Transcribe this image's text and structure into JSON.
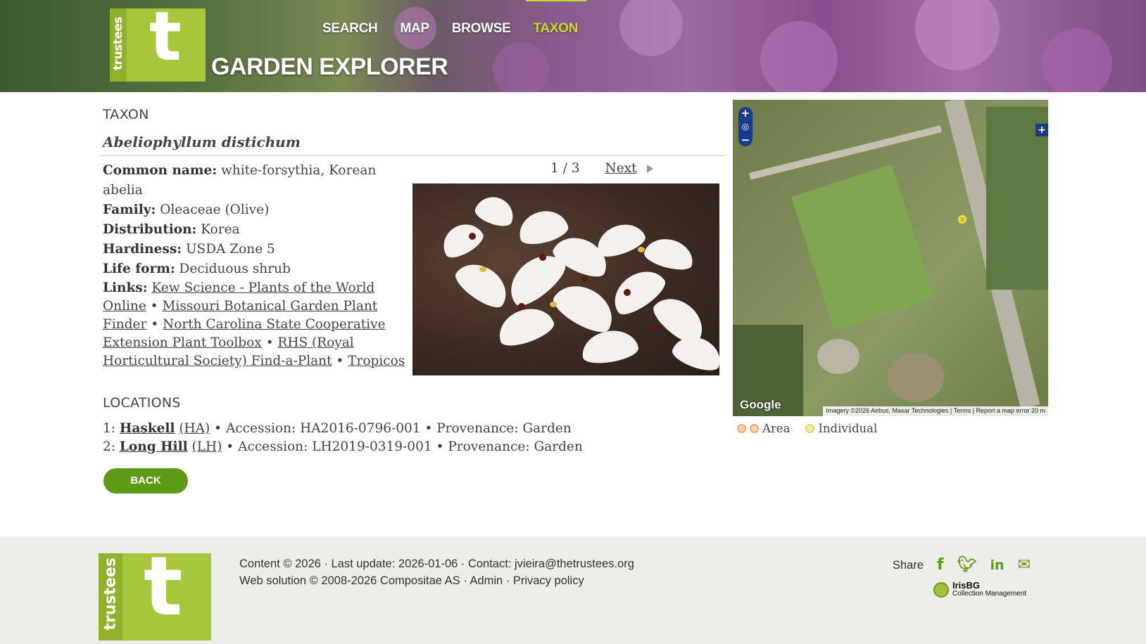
{
  "header": {
    "logo_word": "trustees",
    "logo_letter": "t",
    "site_title": "GARDEN EXPLORER",
    "nav": [
      {
        "label": "SEARCH"
      },
      {
        "label": "MAP"
      },
      {
        "label": "BROWSE"
      },
      {
        "label": "TAXON",
        "active": true
      }
    ]
  },
  "taxon": {
    "section_title": "TAXON",
    "name": "Abeliophyllum distichum",
    "facts": [
      {
        "label": "Common name:",
        "value": "white-forsythia, Korean abelia"
      },
      {
        "label": "Family:",
        "value": "Oleaceae (Olive)"
      },
      {
        "label": "Distribution:",
        "value": "Korea"
      },
      {
        "label": "Hardiness:",
        "value": "USDA Zone 5"
      },
      {
        "label": "Life form:",
        "value": "Deciduous shrub"
      }
    ],
    "links_label": "Links:",
    "links": [
      "Kew Science - Plants of the World Online",
      "Missouri Botanical Garden Plant Finder",
      "North Carolina State Cooperative Extension Plant Toolbox",
      "RHS (Royal Horticultural Society) Find-a-Plant",
      "Tropicos"
    ],
    "pager": {
      "current": "1 / 3",
      "next_label": "Next"
    }
  },
  "map": {
    "brand": "Google",
    "attribution": "Imagery ©2026 Airbus, Maxar Technologies",
    "terms": "Terms",
    "report": "Report a map error",
    "scale": "20 m",
    "legend": {
      "area": "Area",
      "individual": "Individual"
    },
    "zoom_in": "+",
    "zoom_out": "−"
  },
  "locations": {
    "section_title": "LOCATIONS",
    "items": [
      {
        "num": "1:",
        "garden": "Haskell",
        "code": "(HA)",
        "accession_label": "Accession:",
        "accession": "HA2016-0796-001",
        "provenance_label": "Provenance:",
        "provenance": "Garden"
      },
      {
        "num": "2:",
        "garden": "Long Hill",
        "code": "(LH)",
        "accession_label": "Accession:",
        "accession": "LH2019-0319-001",
        "provenance_label": "Provenance:",
        "provenance": "Garden"
      }
    ]
  },
  "back_label": "BACK",
  "footer": {
    "line1": "Content © 2026 · Last update: 2026-01-06 · Contact: jvieira@thetrustees.org",
    "line2_prefix": "Web solution © 2008-2026 Compositae AS · ",
    "admin": "Admin",
    "sep": " · ",
    "privacy": "Privacy policy",
    "share_label": "Share",
    "icons": [
      "facebook-icon",
      "twitter-icon",
      "linkedin-icon",
      "email-icon"
    ],
    "iris_title": "IrisBG",
    "iris_sub": "Collection Management"
  },
  "colors": {
    "brand_green": "#a6c63b",
    "button_green": "#5d9a15",
    "nav_active": "#c8d92e"
  }
}
